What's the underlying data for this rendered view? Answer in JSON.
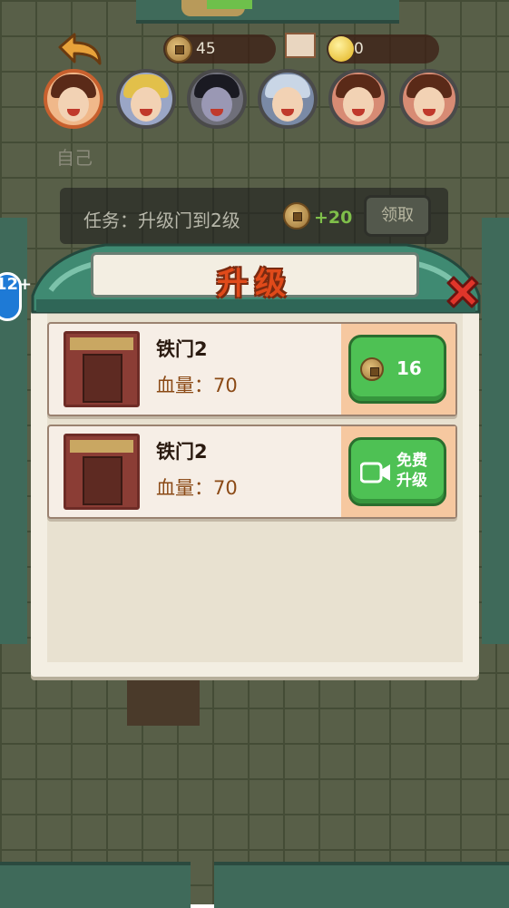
{
  "hud": {
    "coins": "45",
    "gems": "0",
    "self_label": "自己"
  },
  "task": {
    "text": "任务：升级门到2级",
    "reward": "+20",
    "claim_label": "领取"
  },
  "age_badge": "12+",
  "dialog": {
    "title": "升级",
    "items": [
      {
        "name": "铁门2",
        "hp_label": "血量：70",
        "button_price": "16",
        "button_type": "coin"
      },
      {
        "name": "铁门2",
        "hp_label": "血量：70",
        "button_label_line1": "免费",
        "button_label_line2": "升级",
        "button_type": "video"
      }
    ]
  },
  "colors": {
    "title_red": "#e04a1a",
    "button_green": "#4ec154",
    "roof_teal": "#3f6a5a"
  }
}
